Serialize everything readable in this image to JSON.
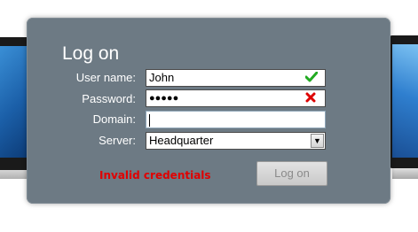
{
  "dialog": {
    "title": "Log on",
    "fields": {
      "username": {
        "label": "User name:",
        "value": "John",
        "status": "valid",
        "status_icon": "check-icon"
      },
      "password": {
        "label": "Password:",
        "value": "●●●●●",
        "status": "invalid",
        "status_icon": "x-icon"
      },
      "domain": {
        "label": "Domain:",
        "value": ""
      },
      "server": {
        "label": "Server:",
        "value": "Headquarter"
      }
    },
    "error_message": "Invalid credentials",
    "logon_button": "Log on",
    "colors": {
      "panel": "#6d7a84",
      "error": "#e00000",
      "valid": "#22aa22",
      "invalid": "#dd0000"
    }
  }
}
